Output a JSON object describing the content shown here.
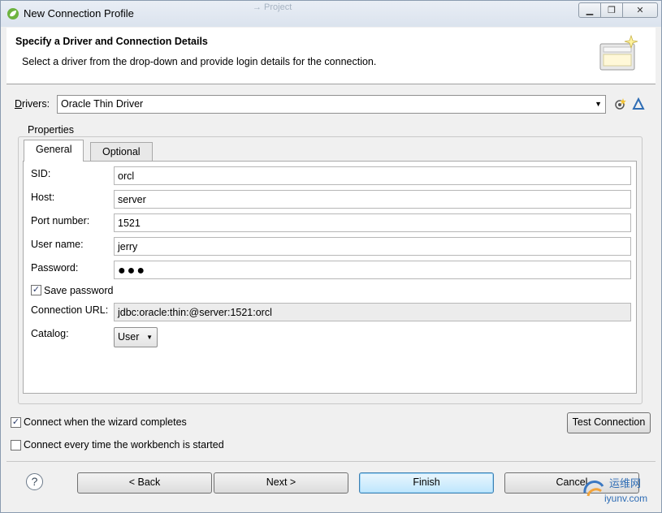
{
  "window": {
    "title": "New Connection Profile",
    "background_hint": "→ Project"
  },
  "banner": {
    "title": "Specify a Driver and Connection Details",
    "description": "Select a driver from the drop-down and provide login details for the connection."
  },
  "drivers": {
    "label": "Drivers:",
    "selected": "Oracle Thin Driver"
  },
  "properties": {
    "label": "Properties",
    "tabs": [
      {
        "label": "General",
        "active": true
      },
      {
        "label": "Optional",
        "active": false
      }
    ],
    "fields": {
      "sid": {
        "label": "SID:",
        "value": "orcl"
      },
      "host": {
        "label": "Host:",
        "value": "server"
      },
      "port": {
        "label": "Port number:",
        "value": "1521"
      },
      "user": {
        "label": "User name:",
        "value": "jerry"
      },
      "password": {
        "label": "Password:",
        "value": "●●●"
      },
      "save_password": {
        "label": "Save password",
        "checked": true
      },
      "url": {
        "label": "Connection URL:",
        "value": "jdbc:oracle:thin:@server:1521:orcl"
      },
      "catalog": {
        "label": "Catalog:",
        "value": "User"
      }
    }
  },
  "options": {
    "connect_when_complete": {
      "label": "Connect when the wizard completes",
      "checked": true
    },
    "connect_every_time": {
      "label": "Connect every time the workbench is started",
      "checked": false
    }
  },
  "buttons": {
    "test_connection": "Test Connection",
    "back": "< Back",
    "next": "Next >",
    "finish": "Finish",
    "cancel": "Cancel"
  },
  "watermark": {
    "line1": "运维网",
    "line2": "iyunv.com"
  },
  "colors": {
    "accent_button": "#bee6fd",
    "panel_bg": "#f0f0f0",
    "watermark": "#2f6db5"
  }
}
